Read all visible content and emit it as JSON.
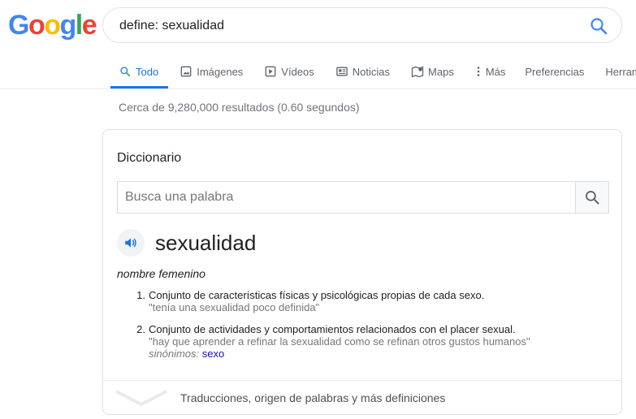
{
  "logo": {
    "letters": [
      "G",
      "o",
      "o",
      "g",
      "l",
      "e"
    ],
    "colors": [
      "#4285F4",
      "#EA4335",
      "#FBBC05",
      "#4285F4",
      "#34A853",
      "#EA4335"
    ]
  },
  "search": {
    "query": "define: sexualidad",
    "icon": "search-icon",
    "accent": "#4285F4"
  },
  "tabs": [
    {
      "label": "Todo",
      "icon": "search-icon",
      "active": true
    },
    {
      "label": "Imágenes",
      "icon": "image-icon"
    },
    {
      "label": "Vídeos",
      "icon": "play-icon"
    },
    {
      "label": "Noticias",
      "icon": "news-icon"
    },
    {
      "label": "Maps",
      "icon": "map-icon"
    },
    {
      "label": "Más",
      "icon": "more-vert-icon"
    },
    {
      "label": "Preferencias"
    },
    {
      "label": "Herramie"
    }
  ],
  "results_count": "Cerca de 9,280,000 resultados (0.60 segundos)",
  "dictionary": {
    "title": "Diccionario",
    "search_placeholder": "Busca una palabra",
    "word": "sexualidad",
    "part_of_speech": "nombre femenino",
    "definitions": [
      {
        "number": "1.",
        "text": "Conjunto de características físicas y psicológicas propias de cada sexo.",
        "example": "\"tenía una sexualidad poco definida\""
      },
      {
        "number": "2.",
        "text": "Conjunto de actividades y comportamientos relacionados con el placer sexual.",
        "example": "\"hay que aprender a refinar la sexualidad como se refinan otros gustos humanos\"",
        "synonyms_label": "sinónimos:",
        "synonyms": "sexo"
      }
    ],
    "footer_link": "Traducciones, origen de palabras y más definiciones"
  }
}
